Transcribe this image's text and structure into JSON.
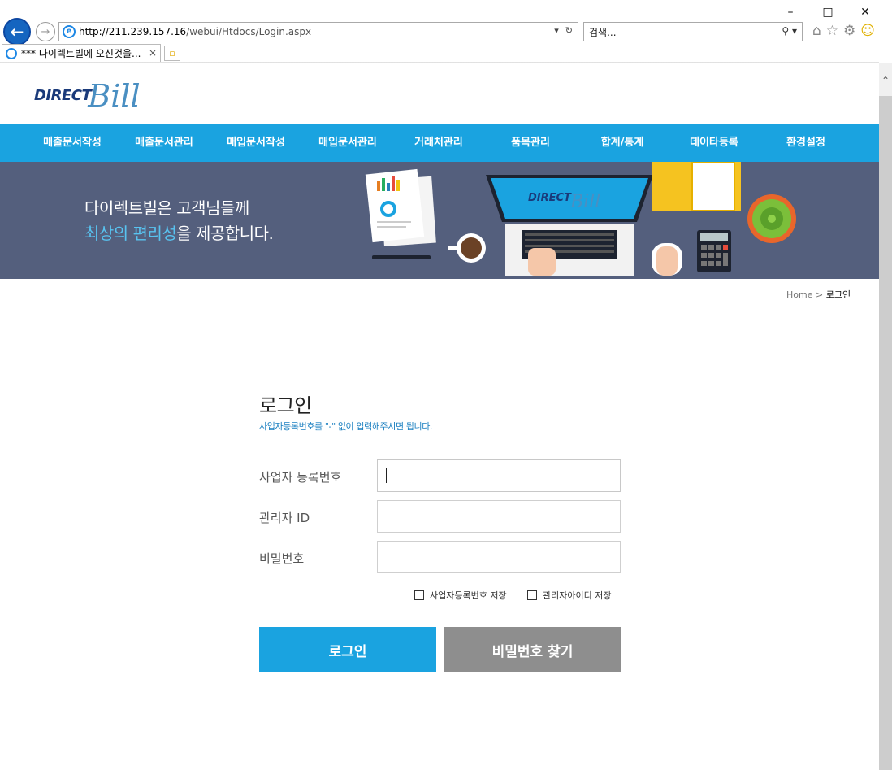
{
  "browser": {
    "window_buttons": [
      "–",
      "□",
      "✕"
    ],
    "url_host": "http://211.239.157.16",
    "url_path": "/webui/Htdocs/Login.aspx",
    "search_placeholder": "검색...",
    "tab_title": "*** 다이렉트빌에 오신것을...",
    "tab_close": "×"
  },
  "logo": {
    "direct": "DIRECT",
    "bill": "Bill"
  },
  "nav": {
    "items": [
      "매출문서작성",
      "매출문서관리",
      "매입문서작성",
      "매입문서관리",
      "거래처관리",
      "품목관리",
      "합계/통계",
      "데이타등록",
      "환경설정"
    ]
  },
  "banner": {
    "line1": "다이렉트빌은 고객님들께",
    "line2_highlight": "최상의 편리성",
    "line2_rest": "을 제공합니다.",
    "laptop_logo_direct": "DIRECT",
    "laptop_logo_bill": "Bill"
  },
  "breadcrumb": {
    "home": "Home",
    "separator": ">",
    "current": "로그인"
  },
  "login": {
    "title": "로그인",
    "subtitle": "사업자등록번호를 \"-\" 없이 입력해주시면 됩니다.",
    "fields": [
      {
        "label": "사업자 등록번호",
        "value": ""
      },
      {
        "label": "관리자 ID",
        "value": ""
      },
      {
        "label": "비밀번호",
        "value": ""
      }
    ],
    "save_biz_label": "사업자등록번호 저장",
    "save_admin_label": "관리자아이디 저장",
    "login_button": "로그인",
    "find_pw_button": "비밀번호 찾기"
  },
  "colors": {
    "nav_bg": "#1aa3e0",
    "banner_bg": "#545f7d",
    "highlight": "#58c3f0",
    "login_button": "#1aa3e0",
    "find_button": "#8e8e8e",
    "subtitle_text": "#1a7fc0"
  }
}
